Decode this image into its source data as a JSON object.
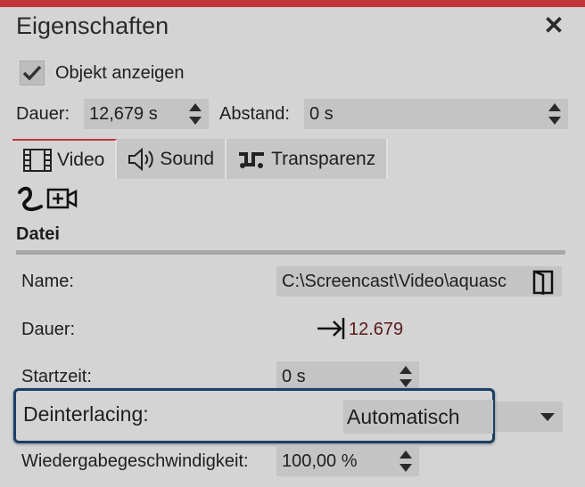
{
  "window": {
    "title": "Eigenschaften",
    "close_glyph": "✕"
  },
  "visibility": {
    "label": "Objekt anzeigen",
    "checked": true
  },
  "timing": {
    "dauer_label": "Dauer:",
    "dauer_value": "12,679 s",
    "abstand_label": "Abstand:",
    "abstand_value": "0 s"
  },
  "tabs": [
    {
      "label": "Video",
      "icon": "film-strip-icon",
      "active": true
    },
    {
      "label": "Sound",
      "icon": "speaker-icon",
      "active": false
    },
    {
      "label": "Transparenz",
      "icon": "wave-icon",
      "active": false
    }
  ],
  "toolbar": {
    "icons": [
      "curve-path-icon",
      "add-camera-icon"
    ]
  },
  "file_section": {
    "title": "Datei",
    "name_label": "Name:",
    "name_value": "C:\\Screencast\\Video\\aquasc",
    "dauer_label": "Dauer:",
    "dauer_value": "12.679",
    "startzeit_label": "Startzeit:",
    "startzeit_value": "0 s",
    "deinterlacing_label": "Deinterlacing:",
    "deinterlacing_value": "Automatisch",
    "speed_label": "Wiedergabegeschwindigkeit:",
    "speed_value": "100,00 %"
  },
  "colors": {
    "accent": "#c0353a",
    "highlight_border": "#1c3f66",
    "duration_text": "#5a1a1a"
  }
}
